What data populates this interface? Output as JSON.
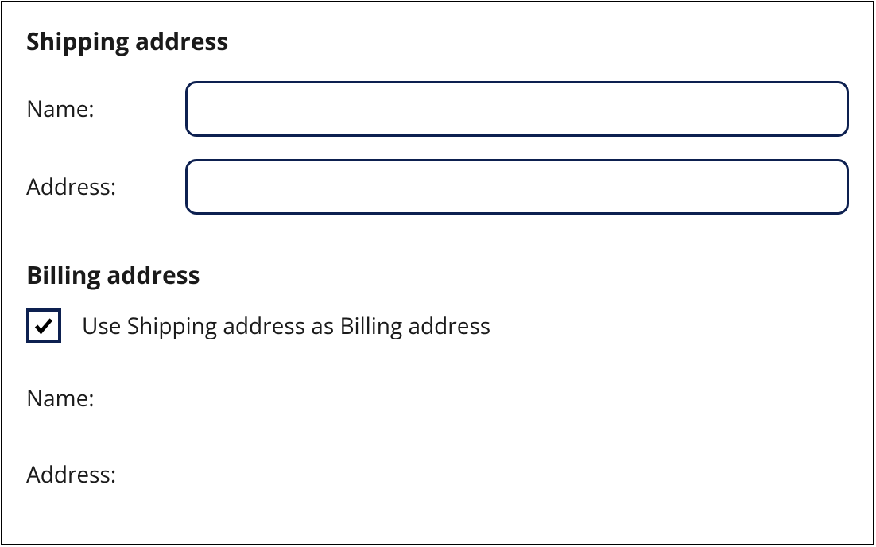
{
  "shipping": {
    "heading": "Shipping address",
    "name_label": "Name:",
    "name_value": "",
    "address_label": "Address:",
    "address_value": ""
  },
  "billing": {
    "heading": "Billing address",
    "checkbox_label": "Use Shipping address as Billing address",
    "checkbox_checked": true,
    "name_label": "Name:",
    "address_label": "Address:"
  }
}
